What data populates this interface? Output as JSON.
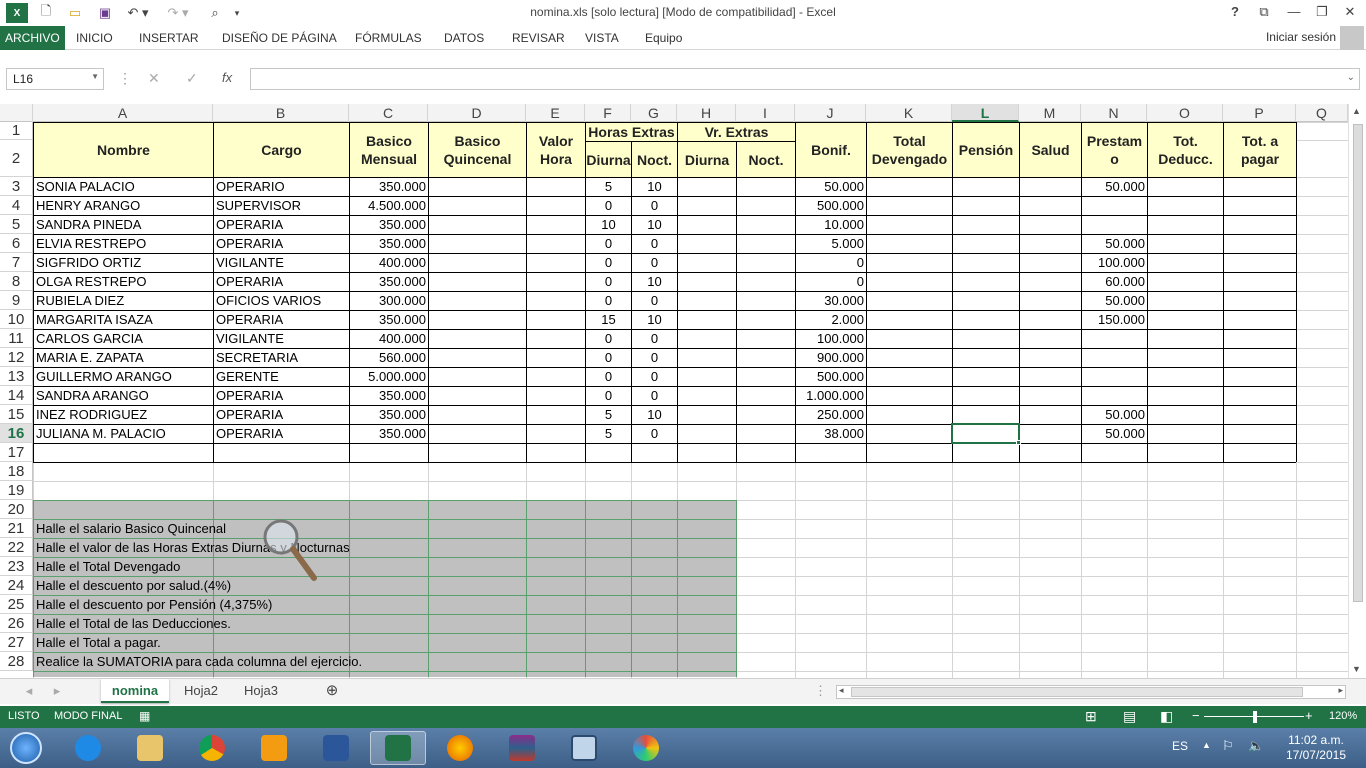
{
  "window": {
    "title": "nomina.xls  [solo lectura]  [Modo de compatibilidad] - Excel",
    "help": "?",
    "signin": "Iniciar sesión"
  },
  "ribbon": {
    "tabs": [
      "ARCHIVO",
      "INICIO",
      "INSERTAR",
      "DISEÑO DE PÁGINA",
      "FÓRMULAS",
      "DATOS",
      "REVISAR",
      "VISTA",
      "Equipo"
    ]
  },
  "formula_bar": {
    "name_box": "L16",
    "cancel": "✕",
    "enter": "✓",
    "fx": "fx",
    "formula": ""
  },
  "columns": [
    "A",
    "B",
    "C",
    "D",
    "E",
    "F",
    "G",
    "H",
    "I",
    "J",
    "K",
    "L",
    "M",
    "N",
    "O",
    "P",
    "Q"
  ],
  "rows": [
    "1",
    "2",
    "3",
    "4",
    "5",
    "6",
    "7",
    "8",
    "9",
    "10",
    "11",
    "12",
    "13",
    "14",
    "15",
    "16",
    "17",
    "18",
    "19",
    "20",
    "21",
    "22",
    "23",
    "24",
    "25",
    "26",
    "27",
    "28"
  ],
  "table_headers": {
    "nombre": "Nombre",
    "cargo": "Cargo",
    "basico_mensual": "Basico Mensual",
    "basico_quincenal": "Basico Quincenal",
    "valor_hora": "Valor Hora",
    "horas_extras": "Horas Extras",
    "diurna": "Diurna",
    "noct": "Noct.",
    "vr_extras": "Vr. Extras",
    "vr_diurna": "Diurna",
    "vr_noct": "Noct.",
    "bonif": "Bonif.",
    "total_devengado": "Total Devengado",
    "pension": "Pensión",
    "salud": "Salud",
    "prestamo": "Prestam o",
    "tot_deducc": "Tot. Deducc.",
    "tot_pagar": "Tot. a pagar"
  },
  "employees": [
    {
      "nombre": "SONIA PALACIO",
      "cargo": "OPERARIO",
      "basico": "350.000",
      "diurna": "5",
      "noct": "10",
      "bonif": "50.000",
      "prestamo": "50.000"
    },
    {
      "nombre": "HENRY ARANGO",
      "cargo": "SUPERVISOR",
      "basico": "4.500.000",
      "diurna": "0",
      "noct": "0",
      "bonif": "500.000",
      "prestamo": ""
    },
    {
      "nombre": "SANDRA PINEDA",
      "cargo": "OPERARIA",
      "basico": "350.000",
      "diurna": "10",
      "noct": "10",
      "bonif": "10.000",
      "prestamo": ""
    },
    {
      "nombre": "ELVIA RESTREPO",
      "cargo": "OPERARIA",
      "basico": "350.000",
      "diurna": "0",
      "noct": "0",
      "bonif": "5.000",
      "prestamo": "50.000"
    },
    {
      "nombre": "SIGFRIDO ORTIZ",
      "cargo": "VIGILANTE",
      "basico": "400.000",
      "diurna": "0",
      "noct": "0",
      "bonif": "0",
      "prestamo": "100.000"
    },
    {
      "nombre": "OLGA RESTREPO",
      "cargo": "OPERARIA",
      "basico": "350.000",
      "diurna": "0",
      "noct": "10",
      "bonif": "0",
      "prestamo": "60.000"
    },
    {
      "nombre": "RUBIELA DIEZ",
      "cargo": "OFICIOS VARIOS",
      "basico": "300.000",
      "diurna": "0",
      "noct": "0",
      "bonif": "30.000",
      "prestamo": "50.000"
    },
    {
      "nombre": "MARGARITA ISAZA",
      "cargo": "OPERARIA",
      "basico": "350.000",
      "diurna": "15",
      "noct": "10",
      "bonif": "2.000",
      "prestamo": "150.000"
    },
    {
      "nombre": "CARLOS GARCIA",
      "cargo": "VIGILANTE",
      "basico": "400.000",
      "diurna": "0",
      "noct": "0",
      "bonif": "100.000",
      "prestamo": ""
    },
    {
      "nombre": "MARIA E. ZAPATA",
      "cargo": "SECRETARIA",
      "basico": "560.000",
      "diurna": "0",
      "noct": "0",
      "bonif": "900.000",
      "prestamo": ""
    },
    {
      "nombre": "GUILLERMO ARANGO",
      "cargo": "GERENTE",
      "basico": "5.000.000",
      "diurna": "0",
      "noct": "0",
      "bonif": "500.000",
      "prestamo": ""
    },
    {
      "nombre": "SANDRA ARANGO",
      "cargo": "OPERARIA",
      "basico": "350.000",
      "diurna": "0",
      "noct": "0",
      "bonif": "1.000.000",
      "prestamo": ""
    },
    {
      "nombre": "INEZ RODRIGUEZ",
      "cargo": "OPERARIA",
      "basico": "350.000",
      "diurna": "5",
      "noct": "10",
      "bonif": "250.000",
      "prestamo": "50.000"
    },
    {
      "nombre": "JULIANA M. PALACIO",
      "cargo": "OPERARIA",
      "basico": "350.000",
      "diurna": "5",
      "noct": "0",
      "bonif": "38.000",
      "prestamo": "50.000"
    }
  ],
  "tasks": [
    "Halle el salario Basico Quincenal",
    "Halle el valor de las Horas Extras Diurnas y Nocturnas",
    "Halle el Total Devengado",
    "Halle el descuento por salud.(4%)",
    "Halle el descuento por Pensión (4,375%)",
    "Halle el Total de las Deducciones.",
    "Halle el Total a pagar.",
    "Realice la SUMATORIA para cada columna del ejercicio."
  ],
  "sheets": [
    "nomina",
    "Hoja2",
    "Hoja3"
  ],
  "status": {
    "ready": "LISTO",
    "mode": "MODO FINAL",
    "zoom": "120%"
  },
  "taskbar": {
    "lang": "ES",
    "time": "11:02 a.m.",
    "date": "17/07/2015"
  },
  "colors": {
    "excel_green": "#217346",
    "header_fill": "#ffffcc",
    "task_fill": "#c0c0c0"
  }
}
